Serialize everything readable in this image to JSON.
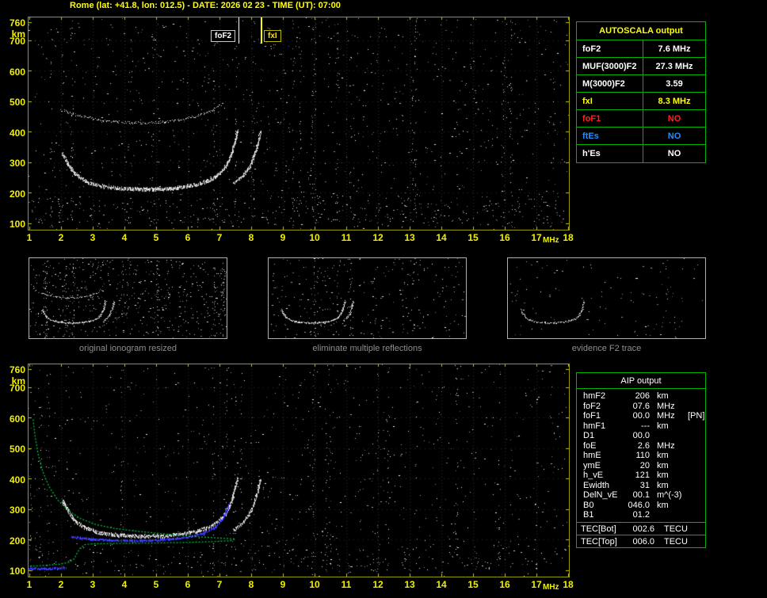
{
  "header": {
    "title": "Rome (lat: +41.8, lon: 012.5) - DATE: 2026 02 23 - TIME (UT): 07:00"
  },
  "colors": {
    "background": "#000000",
    "axis_labels": "#f0f000",
    "plot_border": "#9a9a00",
    "table_border": "#00b400",
    "autoscala_header": "#ffff00",
    "trace_white": "#ffffff",
    "restored_trace_blue": "#3a3aff",
    "profile_green": "#00cc44",
    "foF1_red": "#ff2020",
    "ftEs_blue": "#2090ff",
    "caption_gray": "#8f8f8f"
  },
  "axes": {
    "x_ticks": [
      1,
      2,
      3,
      4,
      5,
      6,
      7,
      8,
      9,
      10,
      11,
      12,
      13,
      14,
      15,
      16,
      17,
      18
    ],
    "x_unit": "MHz",
    "y_ticks": [
      760,
      700,
      600,
      500,
      400,
      300,
      200,
      100
    ],
    "y_unit": "km"
  },
  "autoscala_table": {
    "title": "AUTOSCALA output",
    "rows": [
      {
        "label": "foF2",
        "value": "7.6 MHz",
        "color": "#ffffff"
      },
      {
        "label": "MUF(3000)F2",
        "value": "27.3 MHz",
        "color": "#ffffff"
      },
      {
        "label": "M(3000)F2",
        "value": "3.59",
        "color": "#ffffff"
      },
      {
        "label": "fxI",
        "value": "8.3 MHz",
        "color": "#ffff00"
      },
      {
        "label": "foF1",
        "value": "NO",
        "color": "#ff2020"
      },
      {
        "label": "ftEs",
        "value": "NO",
        "color": "#2090ff"
      },
      {
        "label": "h'Es",
        "value": "NO",
        "color": "#ffffff"
      }
    ]
  },
  "aip_table": {
    "title": "AIP output",
    "rows": [
      {
        "label": "hmF2",
        "value": "206",
        "unit": "km",
        "note": ""
      },
      {
        "label": "foF2",
        "value": "07.6",
        "unit": "MHz",
        "note": ""
      },
      {
        "label": "foF1",
        "value": "00.0",
        "unit": "MHz",
        "note": "[PN]"
      },
      {
        "label": "hmF1",
        "value": "---",
        "unit": "km",
        "note": ""
      },
      {
        "label": "D1",
        "value": "00.0",
        "unit": "",
        "note": ""
      },
      {
        "label": "foE",
        "value": "2.6",
        "unit": "MHz",
        "note": ""
      },
      {
        "label": "hmE",
        "value": "110",
        "unit": "km",
        "note": ""
      },
      {
        "label": "ymE",
        "value": "20",
        "unit": "km",
        "note": ""
      },
      {
        "label": "h_vE",
        "value": "121",
        "unit": "km",
        "note": ""
      },
      {
        "label": "Ewidth",
        "value": "31",
        "unit": "km",
        "note": ""
      },
      {
        "label": "DelN_vE",
        "value": "00.1",
        "unit": "m^(-3)",
        "note": ""
      },
      {
        "label": "B0",
        "value": "046.0",
        "unit": "km",
        "note": ""
      },
      {
        "label": "B1",
        "value": "01.2",
        "unit": "",
        "note": ""
      }
    ],
    "tec_rows": [
      {
        "label": "TEC[Bot]",
        "value": "002.6",
        "unit": "TECU"
      },
      {
        "label": "TEC[Top]",
        "value": "006.0",
        "unit": "TECU"
      }
    ]
  },
  "thumbnails": [
    {
      "caption": "original ionogram resized"
    },
    {
      "caption": "eliminate multiple reflections"
    },
    {
      "caption": "evidence F2 trace"
    }
  ],
  "chart_data": [
    {
      "id": "scaled_ionogram",
      "type": "scatter",
      "title": "scaled ionogram with foF2 / fxI markers",
      "xlabel": "MHz",
      "ylabel": "km",
      "xlim": [
        1,
        18
      ],
      "ylim": [
        100,
        760
      ],
      "grid": true,
      "ticks": true,
      "seed": 42,
      "noise_density": 0.0055,
      "noise_cols": 25,
      "band_noise": {
        "h0": 100,
        "h1": 190,
        "density": 0.012
      },
      "markers": [
        {
          "label": "foF2",
          "freq": 7.6,
          "color": "#ffffff"
        },
        {
          "label": "fxI",
          "freq": 8.3,
          "color": "#ffff00"
        }
      ],
      "traces": [
        {
          "name": "F2-trace-ordinary",
          "points": [
            [
              2.05,
              330
            ],
            [
              2.2,
              300
            ],
            [
              2.45,
              262
            ],
            [
              2.8,
              238
            ],
            [
              3.2,
              224
            ],
            [
              3.8,
              216
            ],
            [
              4.5,
              212
            ],
            [
              5.2,
              213
            ],
            [
              5.8,
              219
            ],
            [
              6.3,
              228
            ],
            [
              6.7,
              243
            ],
            [
              7.0,
              262
            ],
            [
              7.2,
              287
            ],
            [
              7.38,
              325
            ],
            [
              7.5,
              370
            ],
            [
              7.58,
              405
            ]
          ],
          "spread": 4,
          "density": 2.4,
          "size": 2
        },
        {
          "name": "F2-trace-extraordinary",
          "points": [
            [
              7.45,
              232
            ],
            [
              7.7,
              252
            ],
            [
              7.95,
              285
            ],
            [
              8.1,
              322
            ],
            [
              8.22,
              362
            ],
            [
              8.3,
              402
            ]
          ],
          "spread": 3,
          "density": 1.7,
          "size": 2
        },
        {
          "name": "second-hop-reflection",
          "points": [
            [
              2.0,
              472
            ],
            [
              2.6,
              452
            ],
            [
              3.3,
              438
            ],
            [
              4.1,
              430
            ],
            [
              4.9,
              430
            ],
            [
              5.7,
              438
            ],
            [
              6.3,
              452
            ],
            [
              6.8,
              470
            ],
            [
              7.1,
              492
            ]
          ],
          "spread": 3,
          "density": 0.9,
          "size": 1
        }
      ]
    },
    {
      "id": "restored_ionogram",
      "type": "scatter",
      "title": "restored ionogram with electron density profile",
      "xlabel": "MHz",
      "ylabel": "km",
      "xlim": [
        1,
        18
      ],
      "ylim": [
        100,
        760
      ],
      "grid": true,
      "ticks": true,
      "seed": 77,
      "noise_density": 0.0045,
      "noise_cols": 18,
      "band_noise": {
        "h0": 100,
        "h1": 180,
        "density": 0.008
      },
      "traces": [
        {
          "name": "F2-trace-ordinary",
          "points": [
            [
              2.05,
              330
            ],
            [
              2.2,
              300
            ],
            [
              2.45,
              262
            ],
            [
              2.8,
              238
            ],
            [
              3.2,
              224
            ],
            [
              3.8,
              216
            ],
            [
              4.5,
              212
            ],
            [
              5.2,
              213
            ],
            [
              5.8,
              219
            ],
            [
              6.3,
              228
            ],
            [
              6.7,
              243
            ],
            [
              7.0,
              262
            ],
            [
              7.2,
              287
            ],
            [
              7.38,
              325
            ],
            [
              7.5,
              370
            ],
            [
              7.58,
              405
            ]
          ],
          "spread": 4,
          "density": 2.2,
          "size": 2
        },
        {
          "name": "F2-trace-extraordinary",
          "points": [
            [
              7.45,
              232
            ],
            [
              7.7,
              252
            ],
            [
              7.95,
              285
            ],
            [
              8.1,
              322
            ],
            [
              8.22,
              362
            ],
            [
              8.3,
              402
            ]
          ],
          "spread": 3,
          "density": 1.5,
          "size": 2
        },
        {
          "name": "restored-trace-blue",
          "color": "#3a3aff",
          "points": [
            [
              2.35,
              210
            ],
            [
              3.0,
              202
            ],
            [
              3.8,
              198
            ],
            [
              4.6,
              198
            ],
            [
              5.4,
              202
            ],
            [
              6.0,
              210
            ],
            [
              6.5,
              222
            ],
            [
              6.9,
              244
            ],
            [
              7.15,
              276
            ],
            [
              7.3,
              315
            ]
          ],
          "spread": 2,
          "density": 1.8,
          "size": 2
        },
        {
          "name": "restored-E-trace-blue",
          "color": "#3a3aff",
          "points": [
            [
              1.0,
              107
            ],
            [
              1.6,
              106
            ],
            [
              2.15,
              109
            ]
          ],
          "spread": 2,
          "density": 1.6,
          "size": 2
        },
        {
          "name": "electron-density-profile",
          "style": "line",
          "color": "#00cc44",
          "points": [
            [
              1.12,
              595
            ],
            [
              1.18,
              540
            ],
            [
              1.28,
              480
            ],
            [
              1.42,
              425
            ],
            [
              1.62,
              375
            ],
            [
              1.9,
              330
            ],
            [
              2.25,
              295
            ],
            [
              2.6,
              270
            ],
            [
              3.1,
              250
            ],
            [
              3.7,
              237
            ],
            [
              4.5,
              227
            ],
            [
              5.4,
              218
            ],
            [
              6.3,
              210
            ],
            [
              7.1,
              205
            ],
            [
              7.5,
              203
            ],
            [
              7.35,
              197
            ],
            [
              6.8,
              194
            ],
            [
              5.8,
              191
            ],
            [
              4.6,
              189
            ],
            [
              3.6,
              188
            ],
            [
              3.0,
              187
            ],
            [
              2.75,
              184
            ],
            [
              2.6,
              172
            ],
            [
              2.5,
              155
            ],
            [
              2.42,
              138
            ],
            [
              2.25,
              126
            ],
            [
              1.95,
              120
            ],
            [
              1.5,
              116
            ],
            [
              1.0,
              113
            ]
          ]
        }
      ]
    },
    {
      "id": "thumb_original",
      "ref": "scaled_ionogram",
      "trace_indexes": [
        0,
        1,
        2
      ],
      "noise_density": 0.02,
      "noise_cols": 10,
      "seed": 101,
      "grid": false,
      "ticks": false,
      "band_noise": null
    },
    {
      "id": "thumb_cleaned",
      "ref": "scaled_ionogram",
      "trace_indexes": [
        0,
        1
      ],
      "noise_density": 0.011,
      "noise_cols": 6,
      "seed": 102,
      "grid": false,
      "ticks": false,
      "band_noise": null
    },
    {
      "id": "thumb_f2",
      "ref": "scaled_ionogram",
      "trace_indexes": [
        0
      ],
      "noise_density": 0.004,
      "noise_cols": 3,
      "seed": 103,
      "grid": false,
      "ticks": false,
      "band_noise": null,
      "trace_density_mult": 0.55
    }
  ]
}
